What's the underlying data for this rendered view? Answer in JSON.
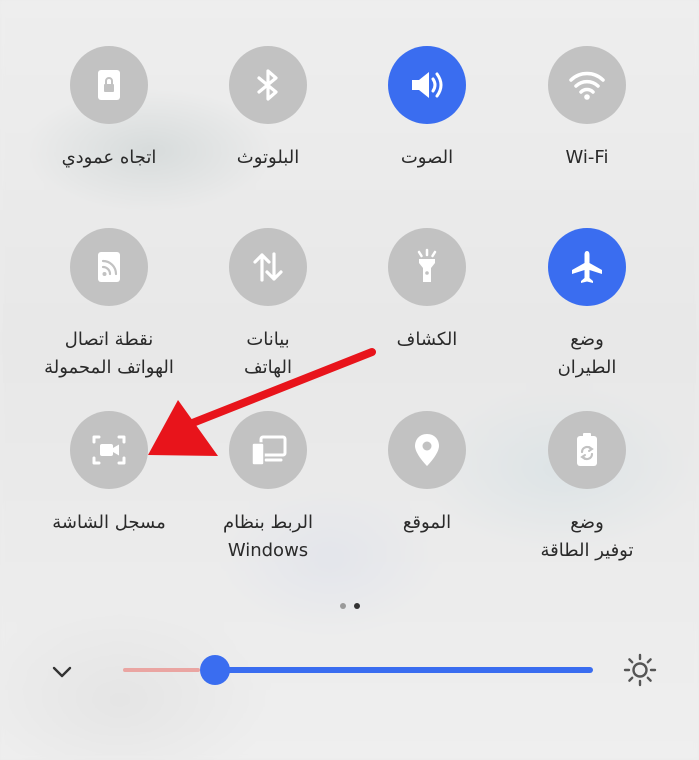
{
  "tiles": [
    {
      "label": "Wi-Fi",
      "icon": "wifi-icon",
      "active": false
    },
    {
      "label": "الصوت",
      "icon": "sound-icon",
      "active": true
    },
    {
      "label": "البلوتوث",
      "icon": "bluetooth-icon",
      "active": false
    },
    {
      "label": "اتجاه عمودي",
      "icon": "portrait-lock-icon",
      "active": false
    },
    {
      "label": "وضع\nالطيران",
      "icon": "airplane-icon",
      "active": true
    },
    {
      "label": "الكشاف",
      "icon": "flashlight-icon",
      "active": false
    },
    {
      "label": "بيانات\nالهاتف",
      "icon": "mobile-data-icon",
      "active": false
    },
    {
      "label": "نقطة اتصال\nالهواتف المحمولة",
      "icon": "hotspot-icon",
      "active": false
    },
    {
      "label": "وضع\nتوفير الطاقة",
      "icon": "power-saving-icon",
      "active": false
    },
    {
      "label": "الموقع",
      "icon": "location-icon",
      "active": false
    },
    {
      "label": "الربط بنظام\nWindows",
      "icon": "link-to-windows-icon",
      "active": false
    },
    {
      "label": "مسجل الشاشة",
      "icon": "screen-recorder-icon",
      "active": false
    }
  ],
  "brightness": {
    "value": 0.195
  },
  "pagination": {
    "total": 2,
    "current": 2
  },
  "colors": {
    "accent": "#3a6df0",
    "inactive": "#c2c2c2",
    "annotation_arrow": "#e8141b"
  }
}
